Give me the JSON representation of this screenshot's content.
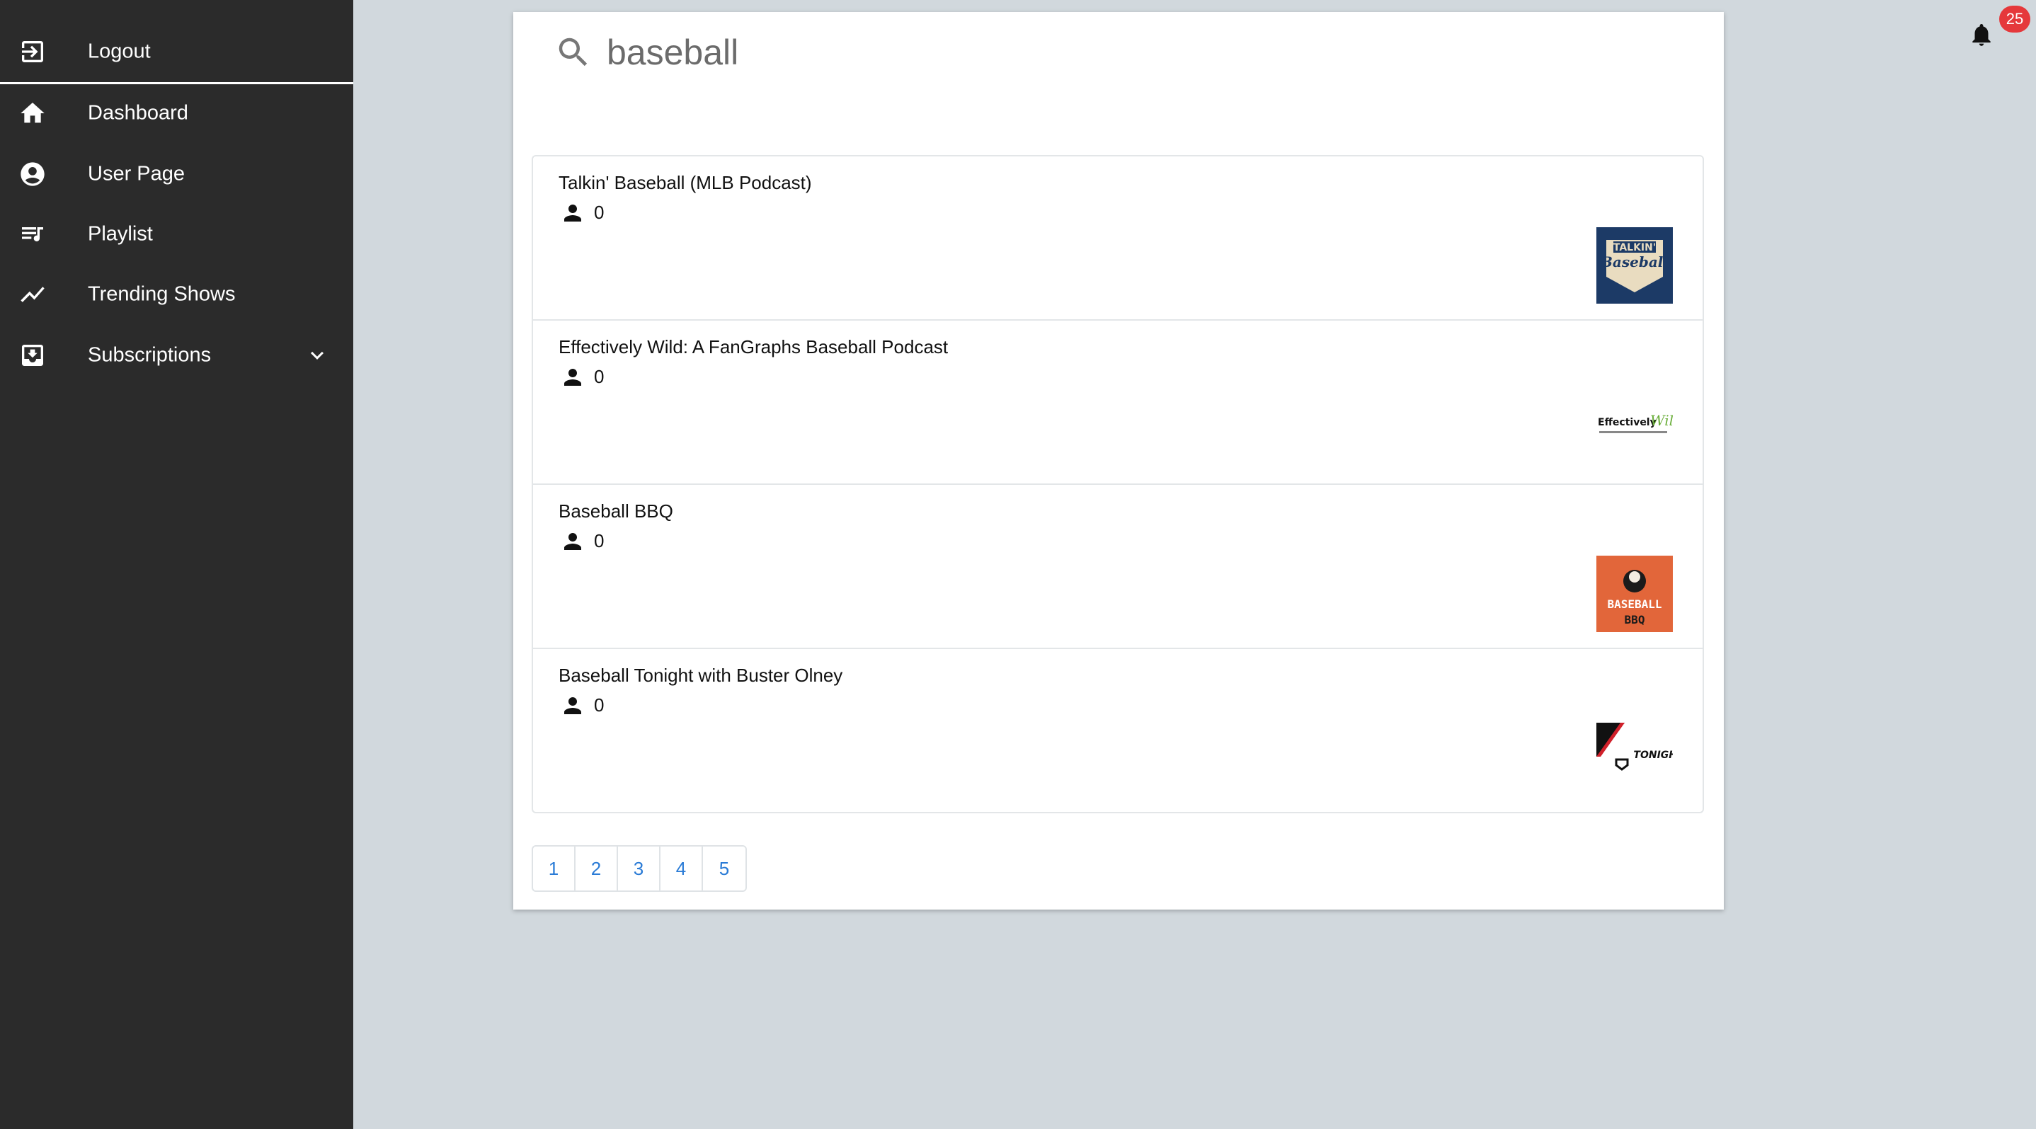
{
  "sidebar": {
    "items": [
      {
        "label": "Logout",
        "icon": "logout-icon"
      },
      {
        "label": "Dashboard",
        "icon": "home-icon"
      },
      {
        "label": "User Page",
        "icon": "account-circle-icon"
      },
      {
        "label": "Playlist",
        "icon": "playlist-icon"
      },
      {
        "label": "Trending Shows",
        "icon": "trending-icon"
      },
      {
        "label": "Subscriptions",
        "icon": "subscriptions-icon"
      }
    ]
  },
  "notifications": {
    "count": "25",
    "icon": "bell-icon"
  },
  "search": {
    "value": "baseball",
    "icon": "search-icon"
  },
  "results": [
    {
      "title": "Talkin' Baseball (MLB Podcast)",
      "subscribers": "0",
      "thumb_label": "TALKIN' Baseball",
      "thumb_color": "#1c3a66"
    },
    {
      "title": "Effectively Wild: A FanGraphs Baseball Podcast",
      "subscribers": "0",
      "thumb_label": "Effectively Wild",
      "thumb_color": "#ffffff"
    },
    {
      "title": "Baseball BBQ",
      "subscribers": "0",
      "thumb_label": "BASEBALL BBQ",
      "thumb_color": "#e2663a"
    },
    {
      "title": "Baseball Tonight with Buster Olney",
      "subscribers": "0",
      "thumb_label": "BASEBALL TONIGHT",
      "thumb_color": "#ffffff"
    }
  ],
  "pagination": {
    "pages": [
      "1",
      "2",
      "3",
      "4",
      "5"
    ],
    "link_color": "#2a7bd6"
  }
}
